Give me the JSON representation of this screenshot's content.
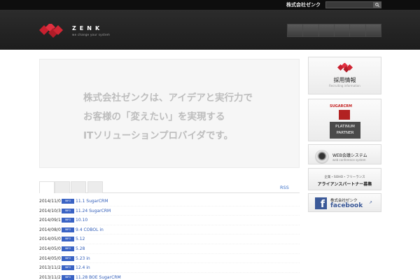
{
  "topbar": {
    "company_name": "株式会社ゼンク",
    "search_placeholder": ""
  },
  "header": {
    "logo_text": "ZENK",
    "logo_tagline": "we change your system",
    "nav_items": [
      "",
      "",
      "",
      "",
      "",
      ""
    ]
  },
  "hero": {
    "lines": [
      "株式会社ゼンクは、アイデアと実行力で",
      "お客様の「変えたい」を実現する",
      "ITソリューションプロバイダです。"
    ]
  },
  "news": {
    "tabs": [
      "",
      "",
      "",
      ""
    ],
    "rss_label": "RSS",
    "badge": "INFO",
    "items": [
      {
        "date": "2014/11/0",
        "title": "11.1 SugarCRM"
      },
      {
        "date": "2014/10/3",
        "title": "11.24 SugarCRM"
      },
      {
        "date": "2014/09/1",
        "title": "10.10"
      },
      {
        "date": "2014/08/0",
        "title": "9.4 COBOL in"
      },
      {
        "date": "2014/05/0",
        "title": "5.12"
      },
      {
        "date": "2014/05/0",
        "title": "5.28"
      },
      {
        "date": "2014/05/0",
        "title": "5.23 in"
      },
      {
        "date": "2013/11/2",
        "title": "12.4 in"
      },
      {
        "date": "2013/11/2",
        "title": "11.28 BOE SugarCRM"
      }
    ]
  },
  "sidebar": {
    "recruit": {
      "title": "採用情報",
      "subtitle": "Recruiting information"
    },
    "sugar": {
      "logo": "SUGARCRM",
      "line1": "PLATINUM",
      "line2": "PARTNER"
    },
    "web_conf": {
      "title": "WEB会議システム",
      "subtitle": "web conference system"
    },
    "alliance": {
      "line1": "企業・SOHO・フリーランス",
      "line2": "アライアンスパートナー募集"
    },
    "facebook": {
      "line1": "株式会社ゼンク",
      "line2": "facebook",
      "icon": "f"
    }
  },
  "colors": {
    "brand_red": "#c8202f",
    "link_blue": "#2e5bb8",
    "badge_blue": "#3a63c4",
    "facebook_blue": "#3b5998"
  }
}
